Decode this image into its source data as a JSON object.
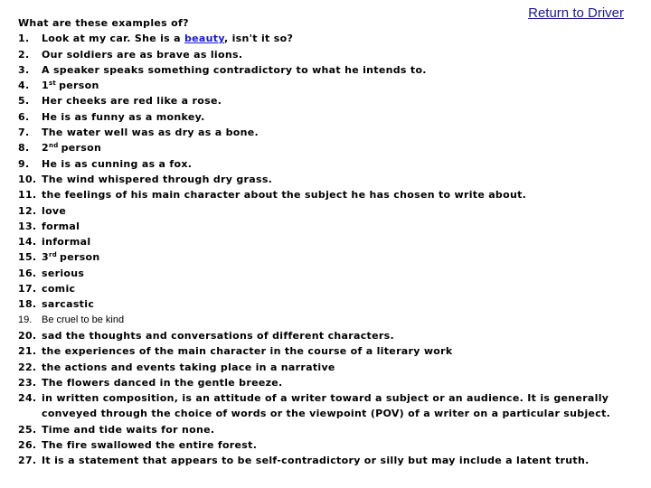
{
  "nav": {
    "return_link": "Return to Driver"
  },
  "colors": {
    "link": "#1a1a8c",
    "inline_link": "#1a1acc",
    "text": "#000000",
    "background": "#ffffff"
  },
  "question": "What are these examples of?",
  "items": [
    {
      "num": "1.",
      "before": "Look at my car. She is a ",
      "link": "beauty",
      "after": ", isn't it so?"
    },
    {
      "num": "2.",
      "text": "Our soldiers are as brave as lions."
    },
    {
      "num": "3.",
      "text": "A speaker speaks something contradictory to what he intends to."
    },
    {
      "num": "4.",
      "ordinal": "1",
      "sup": "st",
      "rest": "person"
    },
    {
      "num": "5.",
      "text": "Her cheeks are red like a rose."
    },
    {
      "num": "6.",
      "text": "He is as funny as a monkey."
    },
    {
      "num": "7.",
      "text": "The water well was as dry as a bone."
    },
    {
      "num": "8.",
      "ordinal": "2",
      "sup": "nd",
      "rest": "person"
    },
    {
      "num": "9.",
      "text": "He is as cunning as a fox."
    },
    {
      "num": "10.",
      "text": "The wind whispered through dry grass."
    },
    {
      "num": "11.",
      "text": "the feelings of his main character about the subject he has chosen to write about."
    },
    {
      "num": "12.",
      "text": "love"
    },
    {
      "num": "13.",
      "text": "formal"
    },
    {
      "num": "14.",
      "text": "informal"
    },
    {
      "num": "15.",
      "ordinal": "3",
      "sup": "rd",
      "rest": "person"
    },
    {
      "num": "16.",
      "text": "serious"
    },
    {
      "num": "17.",
      "text": "comic"
    },
    {
      "num": "18.",
      "text": "sarcastic"
    },
    {
      "num": "19.",
      "text": "Be cruel to be kind"
    },
    {
      "num": "20.",
      "text": "sad the thoughts and conversations of different characters."
    },
    {
      "num": "21.",
      "text": "the experiences of the main character in the course of a literary work"
    },
    {
      "num": "22.",
      "text": "the actions and events taking place in a narrative"
    },
    {
      "num": "23.",
      "text": "The flowers danced in the gentle breeze."
    },
    {
      "num": "24.",
      "text": "in written composition, is an attitude of a writer toward a subject or an audience.  It is generally conveyed through the choice of words or the viewpoint (POV) of a writer on a particular subject."
    },
    {
      "num": "25.",
      "text": "Time and tide waits for none."
    },
    {
      "num": "26.",
      "text": "The fire swallowed the entire forest."
    },
    {
      "num": "27.",
      "text": "It is a statement that appears to be self-contradictory or silly but may include a latent truth."
    }
  ]
}
